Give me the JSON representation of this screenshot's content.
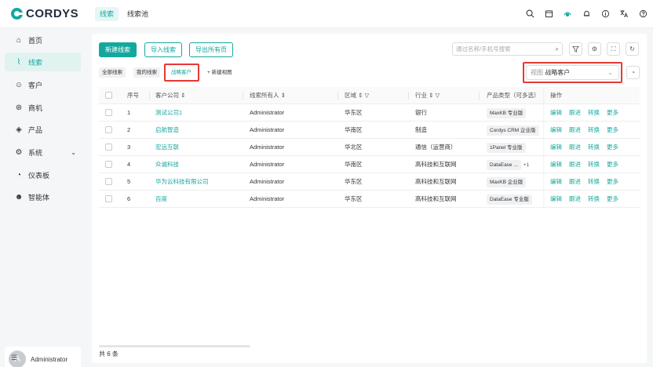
{
  "app": {
    "logo_text": "CORDYS"
  },
  "top_tabs": [
    "线索",
    "线索池"
  ],
  "header_icons": [
    "search-icon",
    "calendar-icon",
    "app-icon",
    "bell-icon",
    "info-icon",
    "translate-icon",
    "help-icon"
  ],
  "sidebar": {
    "items": [
      {
        "label": "首页",
        "icon": "home-icon"
      },
      {
        "label": "线索",
        "icon": "clue-icon",
        "active": true
      },
      {
        "label": "客户",
        "icon": "customer-icon"
      },
      {
        "label": "商机",
        "icon": "opportunity-icon"
      },
      {
        "label": "产品",
        "icon": "product-icon"
      },
      {
        "label": "系统",
        "icon": "system-icon",
        "has_children": true
      },
      {
        "label": "仪表板",
        "icon": "dashboard-icon"
      },
      {
        "label": "智能体",
        "icon": "agent-icon"
      }
    ],
    "user": {
      "initial": "A",
      "name": "Administrator"
    }
  },
  "toolbar": {
    "new_label": "新建线索",
    "import_label": "导入线索",
    "export_label": "导出所有页",
    "search_placeholder": "通过名称/手机号搜索"
  },
  "views": {
    "chips": [
      "全部线索",
      "我的线索",
      "战略客户"
    ],
    "active_chip": "战略客户",
    "new_view_label": "+ 新建视图",
    "select_label": "视图",
    "select_value": "战略客户"
  },
  "table": {
    "columns": [
      "序号",
      "客户公司",
      "线索所有人",
      "区域",
      "行业",
      "产品类型（可多选）",
      "操作"
    ],
    "rows": [
      {
        "no": "1",
        "company": "测试公司1",
        "owner": "Administrator",
        "region": "华东区",
        "industry": "银行",
        "product": "MaxKB 专业版",
        "extra": ""
      },
      {
        "no": "2",
        "company": "启航智造",
        "owner": "Administrator",
        "region": "华南区",
        "industry": "制造",
        "product": "Cordys CRM 企业版",
        "extra": ""
      },
      {
        "no": "3",
        "company": "宏远互联",
        "owner": "Administrator",
        "region": "华北区",
        "industry": "通信（运营商）",
        "product": "1Panel 专业版",
        "extra": ""
      },
      {
        "no": "4",
        "company": "众诚科技",
        "owner": "Administrator",
        "region": "华南区",
        "industry": "高科技和互联网",
        "product": "DataEase ...",
        "extra": "+1"
      },
      {
        "no": "5",
        "company": "华为云科技有限公司",
        "owner": "Administrator",
        "region": "华东区",
        "industry": "高科技和互联网",
        "product": "MaxKB 企业版",
        "extra": ""
      },
      {
        "no": "6",
        "company": "百度",
        "owner": "Administrator",
        "region": "华东区",
        "industry": "高科技和互联网",
        "product": "DataEase 专业版",
        "extra": ""
      }
    ],
    "actions": [
      "编辑",
      "跟进",
      "转换",
      "更多"
    ]
  },
  "footer": {
    "total": "共 6 条"
  },
  "colors": {
    "accent": "#13a89e",
    "highlight": "#e53935"
  }
}
